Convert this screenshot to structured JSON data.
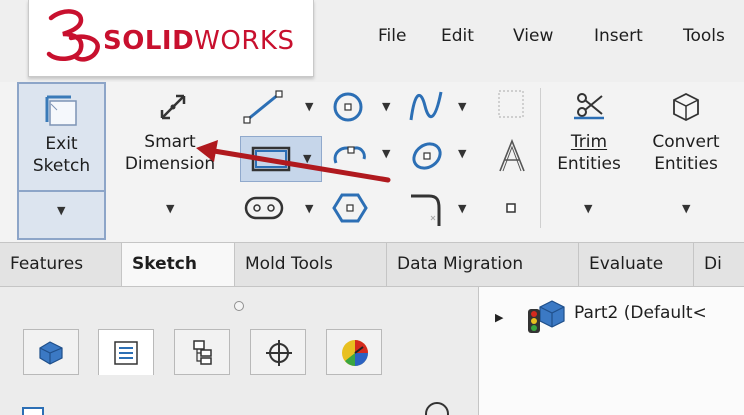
{
  "app": {
    "logo_ds": "3S",
    "logo_solid": "SOLID",
    "logo_works": "WORKS"
  },
  "menu": {
    "items": [
      "File",
      "Edit",
      "View",
      "Insert",
      "Tools"
    ]
  },
  "toolbar": {
    "exit_sketch": [
      "Exit",
      "Sketch"
    ],
    "smart_dimension": [
      "Smart",
      "Dimension"
    ],
    "trim_entities": [
      "Trim",
      "Entities"
    ],
    "convert_entities": [
      "Convert",
      "Entities"
    ]
  },
  "tabs": [
    "Features",
    "Sketch",
    "Mold Tools",
    "Data Migration",
    "Evaluate",
    "Di"
  ],
  "active_tab": "Sketch",
  "tree": {
    "root_label": "Part2  (Default<"
  },
  "colors": {
    "brand_red": "#c8102e",
    "annotation_arrow": "#b0191e",
    "selected_tool": "#dce4ef"
  }
}
